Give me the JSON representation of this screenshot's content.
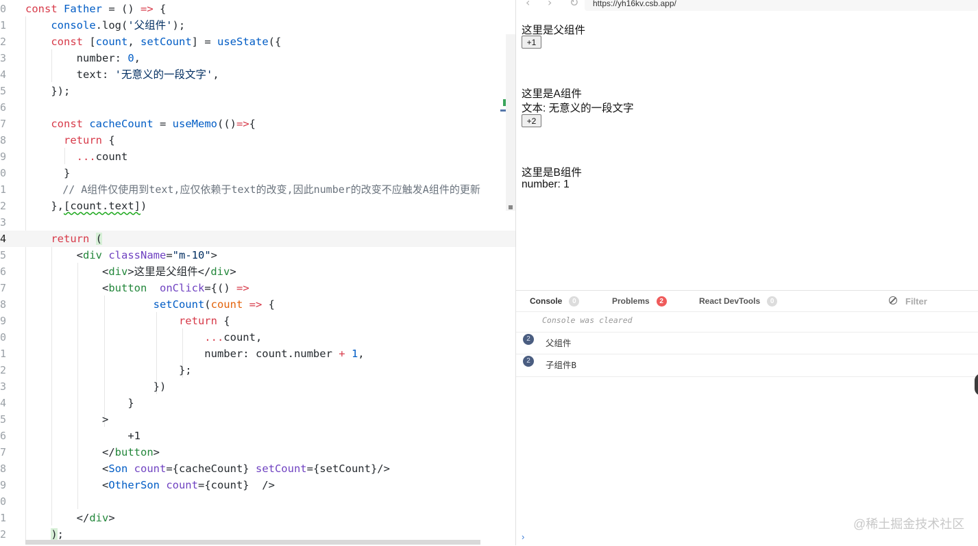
{
  "editor": {
    "line_numbers": [
      "0",
      "1",
      "2",
      "3",
      "4",
      "5",
      "6",
      "7",
      "8",
      "9",
      "0",
      "1",
      "2",
      "3",
      "4",
      "5",
      "6",
      "7",
      "8",
      "9",
      "0",
      "1",
      "2",
      "3",
      "4",
      "5",
      "6",
      "7",
      "8",
      "9",
      "0",
      "1",
      "2"
    ],
    "code": {
      "l0_a": "const",
      "l0_b": "Father",
      "l0_c": " = () ",
      "l0_d": "=>",
      "l0_e": " {",
      "l1_a": "console",
      "l1_b": ".log(",
      "l1_c": "'父组件'",
      "l1_d": ");",
      "l2_a": "const",
      "l2_b": " [",
      "l2_c": "count",
      "l2_d": ", ",
      "l2_e": "setCount",
      "l2_f": "] = ",
      "l2_g": "useState",
      "l2_h": "({",
      "l3_a": "number: ",
      "l3_b": "0",
      "l3_c": ",",
      "l4_a": "text: ",
      "l4_b": "'无意义的一段文字'",
      "l4_c": ",",
      "l5_a": "});",
      "l7_a": "const",
      "l7_b": "cacheCount",
      "l7_c": " = ",
      "l7_d": "useMemo",
      "l7_e": "(()",
      "l7_f": "=>",
      "l7_g": "{",
      "l8_a": "return",
      "l8_b": " {",
      "l9_a": "...",
      "l9_b": "count",
      "l10_a": "}",
      "l11_a": "// A组件仅使用到text,应仅依赖于text的改变,因此number的改变不应触发A组件的更新",
      "l12_a": "},",
      "l12_b": "[count.text]",
      "l12_c": ")",
      "l14_a": "return",
      "l14_b": "(",
      "l15_a": "<",
      "l15_b": "div",
      "l15_c": " className",
      "l15_d": "=",
      "l15_e": "\"m-10\"",
      "l15_f": ">",
      "l16_a": "<",
      "l16_b": "div",
      "l16_c": ">这里是父组件</",
      "l16_d": "div",
      "l16_e": ">",
      "l17_a": "<",
      "l17_b": "button",
      "l17_c": "  onClick",
      "l17_d": "={() ",
      "l17_e": "=>",
      "l18_a": "setCount",
      "l18_b": "(",
      "l18_c": "count",
      "l18_d": " ",
      "l18_e": "=>",
      "l18_f": " {",
      "l19_a": "return",
      "l19_b": " {",
      "l20_a": "...",
      "l20_b": "count,",
      "l21_a": "number: count.number ",
      "l21_b": "+",
      "l21_c": " ",
      "l21_d": "1",
      "l21_e": ",",
      "l22_a": "};",
      "l23_a": "})",
      "l24_a": "}",
      "l25_a": ">",
      "l26_a": "+1",
      "l27_a": "</",
      "l27_b": "button",
      "l27_c": ">",
      "l28_a": "<",
      "l28_b": "Son",
      "l28_c": " count",
      "l28_d": "={cacheCount} ",
      "l28_e": "setCount",
      "l28_f": "={setCount}/>",
      "l29_a": "<",
      "l29_b": "OtherSon",
      "l29_c": " count",
      "l29_d": "={count}  />",
      "l31_a": "</",
      "l31_b": "div",
      "l31_c": ">",
      "l32_a": ")",
      "l32_b": ";"
    }
  },
  "browser": {
    "back_icon": "chevron-left-icon",
    "forward_icon": "chevron-right-icon",
    "reload_icon": "reload-icon",
    "url": "https://yh16kv.csb.app/",
    "preview": {
      "parent_label": "这里是父组件",
      "parent_button": "+1",
      "a_label": "这里是A组件",
      "a_text": "文本: 无意义的一段文字",
      "a_button": "+2",
      "b_label": "这里是B组件",
      "b_number": "number: 1"
    }
  },
  "devtools": {
    "tabs": [
      {
        "label": "Console",
        "badge": "0"
      },
      {
        "label": "Problems",
        "badge": "2"
      },
      {
        "label": "React DevTools",
        "badge": "0"
      }
    ],
    "filter_placeholder": "Filter",
    "cleared_message": "Console was cleared",
    "logs": [
      {
        "count": "2",
        "message": "父组件"
      },
      {
        "count": "2",
        "message": "子组件B"
      }
    ],
    "prompt": "›"
  },
  "watermark": "@稀土掘金技术社区",
  "colors": {
    "keyword": "#d73a49",
    "function": "#005cc5",
    "string": "#032f62",
    "comment": "#6a737d",
    "tag": "#22863a",
    "attribute": "#6f42c1",
    "badge_red": "#ef5b5b",
    "log_count": "#4a5d80"
  }
}
